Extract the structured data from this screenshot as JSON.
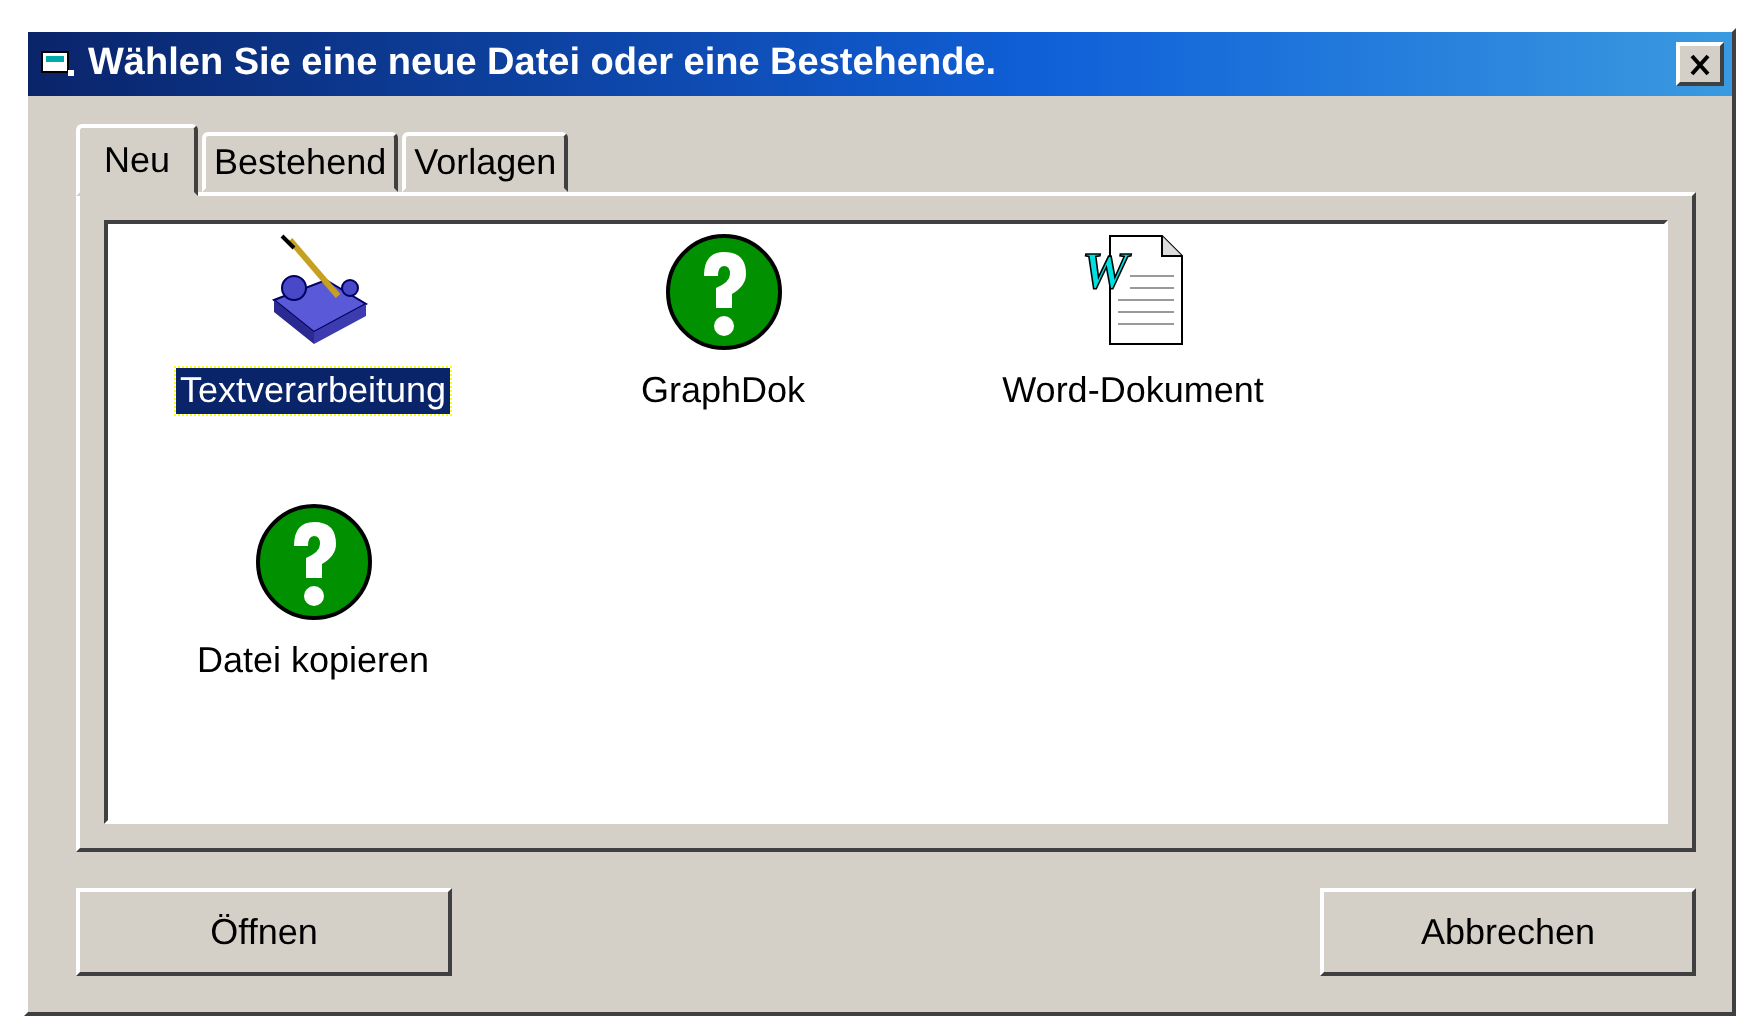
{
  "window": {
    "title": "Wählen Sie eine neue Datei oder eine Bestehende."
  },
  "tabs": [
    {
      "label": "Neu",
      "selected": true
    },
    {
      "label": "Bestehend",
      "selected": false
    },
    {
      "label": "Vorlagen",
      "selected": false
    }
  ],
  "items": [
    {
      "label": "Textverarbeitung",
      "kind": "tool",
      "selected": true
    },
    {
      "label": "GraphDok",
      "kind": "help",
      "selected": false
    },
    {
      "label": "Word-Dokument",
      "kind": "word",
      "icon_text": "W",
      "selected": false
    },
    {
      "label": "Datei kopieren",
      "kind": "help",
      "selected": false
    }
  ],
  "buttons": [
    "Öffnen",
    "Abbrechen"
  ]
}
